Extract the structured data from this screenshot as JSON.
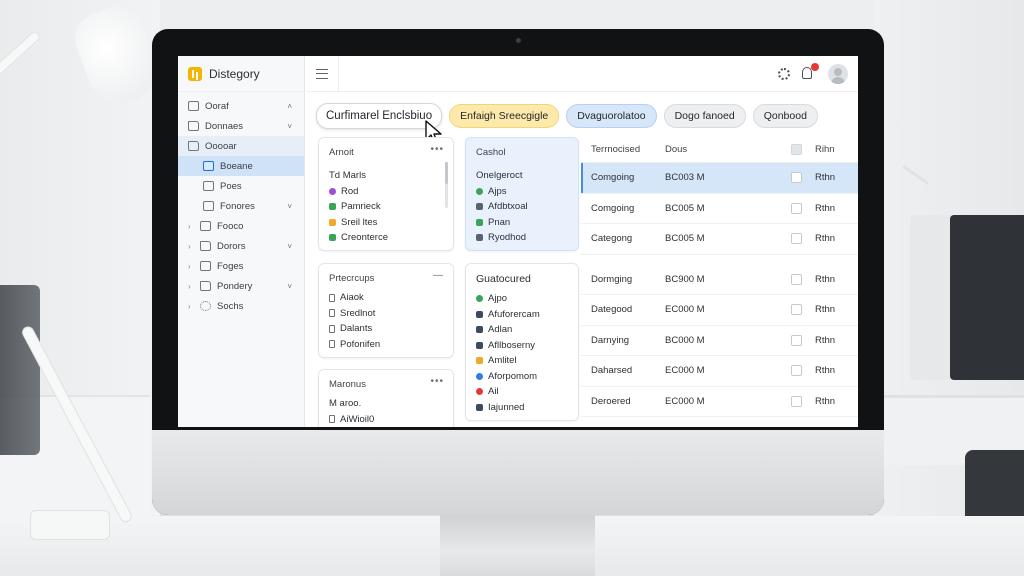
{
  "app": {
    "name": "Distegory"
  },
  "sidebar": {
    "items": [
      {
        "label": "Ooraf",
        "chev": "˄",
        "icon": "page-icon"
      },
      {
        "label": "Donnaes",
        "chev": "˅",
        "icon": "folder-icon"
      },
      {
        "label": "Ooooar",
        "chev": "",
        "icon": "folder-icon"
      },
      {
        "label": "Boeane",
        "chev": "",
        "icon": "document-icon"
      },
      {
        "label": "Poes",
        "chev": "",
        "icon": "page-icon"
      },
      {
        "label": "Fonores",
        "chev": "˅",
        "icon": "grid-icon"
      },
      {
        "label": "Fooco",
        "chev": "",
        "icon": "page-icon"
      },
      {
        "label": "Dorors",
        "chev": "˅",
        "icon": "folder-icon"
      },
      {
        "label": "Foges",
        "chev": "",
        "icon": "page-icon"
      },
      {
        "label": "Pondery",
        "chev": "˅",
        "icon": "folder-icon"
      },
      {
        "label": "Sochs",
        "chev": "",
        "icon": "gear-icon"
      }
    ]
  },
  "topbar": {
    "notification_color": "#e53935"
  },
  "chips": [
    {
      "label": "Curfimarel Enclsbiuo"
    },
    {
      "label": "Enfaigh Sreecgigle"
    },
    {
      "label": "Dvaguorolatoo"
    },
    {
      "label": "Dogo fanoed"
    },
    {
      "label": "Qonbood"
    }
  ],
  "cards": {
    "card1": {
      "title": "Arnoit",
      "more": "•••",
      "items": [
        {
          "label": "Td Marls",
          "color": "",
          "outline": false
        },
        {
          "label": "Rod",
          "color": "#9c4fd6",
          "outline": false
        },
        {
          "label": "Pamrieck",
          "color": "#3aa55a",
          "outline": false
        },
        {
          "label": "Sreil ltes",
          "color": "#f0a92a",
          "outline": false
        },
        {
          "label": "Creonterce",
          "color": "#3aa55a",
          "outline": false
        }
      ]
    },
    "card2": {
      "title": "Cashol",
      "items": [
        {
          "label": "Onelgeroct",
          "color": "#2f7fe0"
        },
        {
          "label": "Ajps",
          "color": "#3aa55a"
        },
        {
          "label": "Afdbtxoal",
          "color": "#5b6270"
        },
        {
          "label": "Pnan",
          "color": "#3aa55a"
        },
        {
          "label": "Ryodhod",
          "color": "#5b6270"
        }
      ]
    },
    "card3": {
      "title": "Prtecrcups",
      "more": "—",
      "items": [
        {
          "label": "Aiaok"
        },
        {
          "label": "Sredlnot"
        },
        {
          "label": "Dalants"
        },
        {
          "label": "Pofonifen"
        }
      ]
    },
    "card4": {
      "title": "Guatocured",
      "items": [
        {
          "label": "Ajpo",
          "color": "#3aa55a"
        },
        {
          "label": "Afuforercam",
          "color": "#3d4a63"
        },
        {
          "label": "Adlan",
          "color": "#3d4a63"
        },
        {
          "label": "Afllboserny",
          "color": "#3d4a63"
        },
        {
          "label": "Amlitel",
          "color": "#f0a92a"
        },
        {
          "label": "Aforpomom",
          "color": "#2f7fe0"
        },
        {
          "label": "Ail",
          "color": "#e53935"
        },
        {
          "label": "Iajunned",
          "color": "#3d4a63"
        }
      ]
    },
    "card5": {
      "title": "Maronus",
      "more": "•••",
      "items": [
        {
          "label": "M aroo."
        },
        {
          "label": "AiWioil0"
        }
      ]
    }
  },
  "table": {
    "headers": {
      "a": "Terrnocised",
      "b": "Dous",
      "d": "Rihn"
    },
    "rows": [
      {
        "a": "Comgoing",
        "b": "BC003 M",
        "d": "Rthn",
        "selected": true
      },
      {
        "a": "Comgoing",
        "b": "BC005 M",
        "d": "Rthn",
        "selected": false
      },
      {
        "a": "Categong",
        "b": "BC005 M",
        "d": "Rthn",
        "selected": false
      },
      {
        "a": "Dormging",
        "b": "BC900 M",
        "d": "Rthn",
        "selected": false
      },
      {
        "a": "Dategood",
        "b": "EC000 M",
        "d": "Rthn",
        "selected": false
      },
      {
        "a": "Darnying",
        "b": "BC000 M",
        "d": "Rthn",
        "selected": false
      },
      {
        "a": "Daharsed",
        "b": "EC000 M",
        "d": "Rthn",
        "selected": false
      },
      {
        "a": "Deroered",
        "b": "EC000 M",
        "d": "Rthn",
        "selected": false
      }
    ]
  },
  "colors": {
    "accent": "#1f6fd1",
    "selection": "#d6e6f9",
    "chip_yellow": "#fde9a9",
    "chip_blue": "#d7e6f9"
  }
}
